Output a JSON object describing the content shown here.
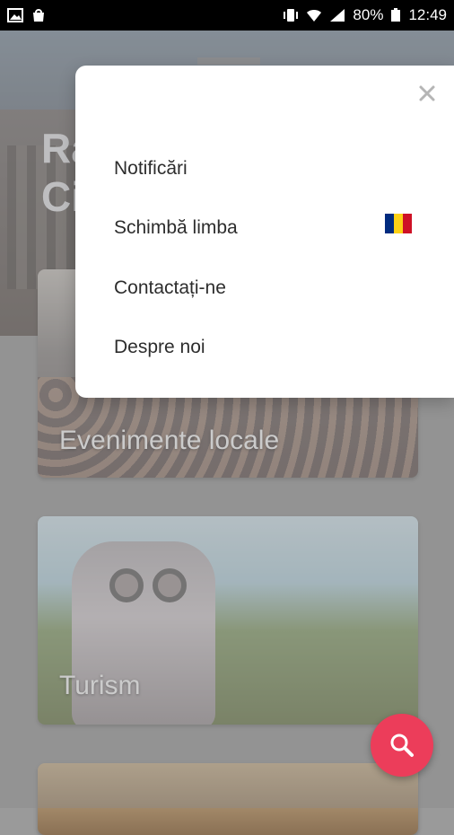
{
  "status_bar": {
    "battery": "80%",
    "time": "12:49",
    "icons": [
      "gallery-icon",
      "shopping-bag-icon",
      "vibrate-icon",
      "wifi-icon",
      "signal-icon",
      "battery-icon"
    ]
  },
  "hero": {
    "title_visible": "Ra\nCi"
  },
  "cards": [
    {
      "label": "Evenimente locale"
    },
    {
      "label": "Turism"
    }
  ],
  "menu": {
    "items": [
      {
        "label": "Notificări"
      },
      {
        "label": "Schimbă limba"
      },
      {
        "label": "Contactați-ne"
      },
      {
        "label": "Despre noi"
      }
    ],
    "language_flag": {
      "colors": [
        "#002b7f",
        "#fcd116",
        "#ce1126"
      ]
    }
  },
  "fab": {
    "icon": "search-icon",
    "color": "#ec3d5a"
  }
}
